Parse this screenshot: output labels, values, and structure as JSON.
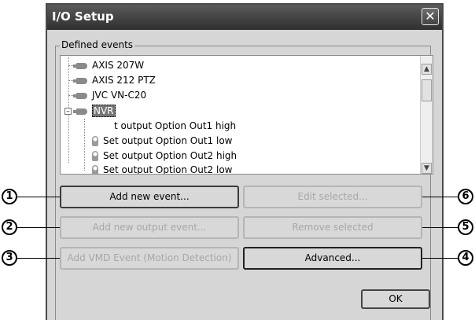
{
  "window": {
    "title": "I/O Setup",
    "close_label": "✕"
  },
  "group": {
    "label": "Defined events"
  },
  "tree": {
    "items": [
      {
        "label": "AXIS 207W",
        "icon": "camera-icon"
      },
      {
        "label": "AXIS 212 PTZ",
        "icon": "camera-icon"
      },
      {
        "label": "JVC VN-C20",
        "icon": "camera-icon"
      },
      {
        "label": "NVR",
        "icon": "camera-icon",
        "selected": true
      },
      {
        "label": "t output Option Out1 high",
        "icon": "bulb-icon"
      },
      {
        "label": "Set output Option Out1 low",
        "icon": "bulb-icon"
      },
      {
        "label": "Set output Option Out2 high",
        "icon": "bulb-icon"
      },
      {
        "label": "Set output Option Out2 low",
        "icon": "bulb-icon"
      }
    ],
    "expander": "–"
  },
  "buttons": {
    "add_new_event": "Add new event...",
    "edit_selected": "Edit selected...",
    "add_new_output_event": "Add new output event...",
    "remove_selected": "Remove selected",
    "add_vmd_event": "Add VMD Event (Motion Detection)",
    "advanced": "Advanced...",
    "ok": "OK"
  },
  "callouts": [
    "1",
    "2",
    "3",
    "4",
    "5",
    "6"
  ]
}
